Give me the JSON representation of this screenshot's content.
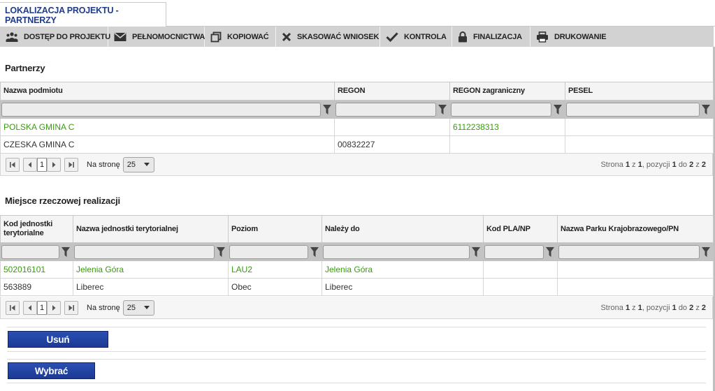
{
  "tab": {
    "title": "LOKALIZACJA PROJEKTU - PARTNERZY"
  },
  "toolbar": {
    "items": [
      {
        "label": "DOSTĘP DO PROJEKTU",
        "icon": "users-icon"
      },
      {
        "label": "PEŁNOMOCNICTWA",
        "icon": "envelope-icon"
      },
      {
        "label": "KOPIOWAĆ",
        "icon": "copy-icon"
      },
      {
        "label": "SKASOWAĆ WNIOSEK",
        "icon": "close-icon"
      },
      {
        "label": "KONTROLA",
        "icon": "checkmark-icon"
      },
      {
        "label": "FINALIZACJA",
        "icon": "lock-icon"
      },
      {
        "label": "DRUKOWANIE",
        "icon": "printer-icon"
      }
    ]
  },
  "partners": {
    "title": "Partnerzy",
    "columns": [
      "Nazwa podmiotu",
      "REGON",
      "REGON zagraniczny",
      "PESEL"
    ],
    "rows": [
      [
        "POLSKA GMINA C",
        "",
        "6112238313",
        ""
      ],
      [
        "CZESKA GMINA C",
        "00832227",
        "",
        ""
      ]
    ],
    "pager": {
      "page": "1",
      "per_page_label": "Na stronę",
      "per_page": "25",
      "info_prefix": "Strona",
      "page_current": "1",
      "of": "z",
      "page_total": "1",
      "items_label": ", pozycji",
      "from": "1",
      "to_label": "do",
      "to": "2",
      "total": "2"
    }
  },
  "locations": {
    "title": "Miejsce rzeczowej realizacji",
    "columns": [
      "Kod jednostki terytorialne",
      "Nazwa jednostki terytorialnej",
      "Poziom",
      "Należy do",
      "Kod PLA/NP",
      "Nazwa Parku Krajobrazowego/PN"
    ],
    "rows": [
      [
        "502016101",
        "Jelenia Góra",
        "LAU2",
        "Jelenia Góra",
        "",
        ""
      ],
      [
        "563889",
        "Liberec",
        "Obec",
        "Liberec",
        "",
        ""
      ]
    ],
    "pager": {
      "page": "1",
      "per_page_label": "Na stronę",
      "per_page": "25",
      "info_prefix": "Strona",
      "page_current": "1",
      "of": "z",
      "page_total": "1",
      "items_label": ", pozycji",
      "from": "1",
      "to_label": "do",
      "to": "2",
      "total": "2"
    }
  },
  "actions": {
    "delete_label": "Usuń",
    "select_label": "Wybrać"
  },
  "colors": {
    "tab_text": "#1f3b8a",
    "link_green": "#3a9a10",
    "button_blue": "#1c3a94",
    "toolbar_bg": "#d2d2d2"
  }
}
